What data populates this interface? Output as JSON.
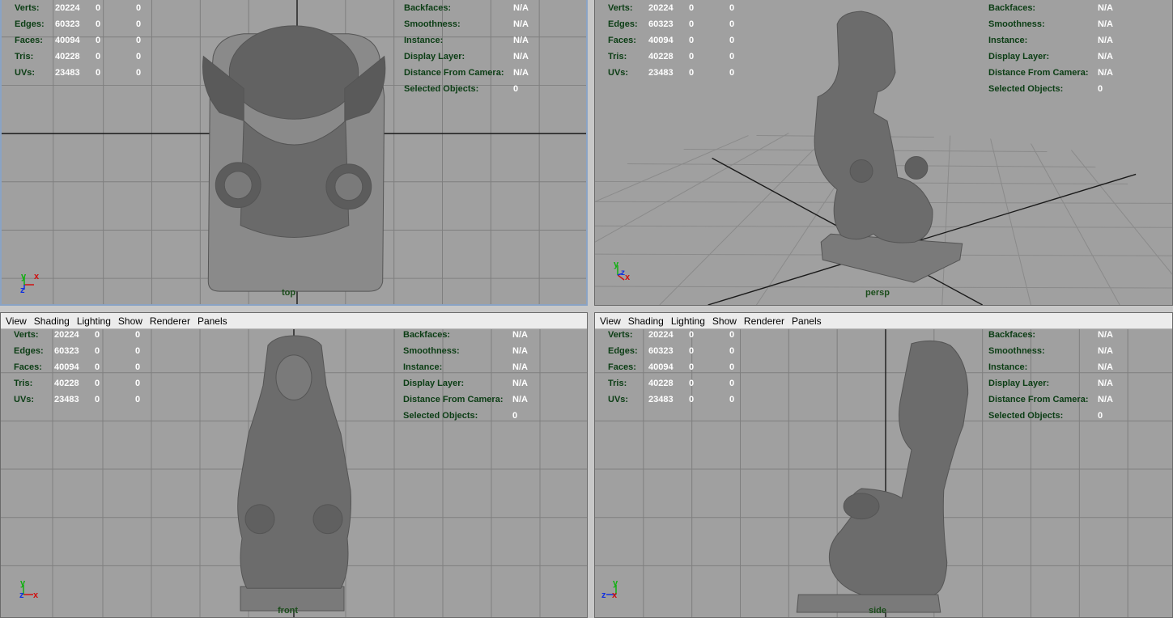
{
  "panel_menu": [
    "View",
    "Shading",
    "Lighting",
    "Show",
    "Renderer",
    "Panels"
  ],
  "hud_left": [
    {
      "key": "Verts:",
      "value": "20224",
      "a": "0",
      "b": "0"
    },
    {
      "key": "Edges:",
      "value": "60323",
      "a": "0",
      "b": "0"
    },
    {
      "key": "Faces:",
      "value": "40094",
      "a": "0",
      "b": "0"
    },
    {
      "key": "Tris:",
      "value": "40228",
      "a": "0",
      "b": "0"
    },
    {
      "key": "UVs:",
      "value": "23483",
      "a": "0",
      "b": "0"
    }
  ],
  "hud_right": [
    {
      "key": "Backfaces:",
      "value": "N/A"
    },
    {
      "key": "Smoothness:",
      "value": "N/A"
    },
    {
      "key": "Instance:",
      "value": "N/A"
    },
    {
      "key": "Display Layer:",
      "value": "N/A"
    },
    {
      "key": "Distance From Camera:",
      "value": "N/A"
    },
    {
      "key": "Selected Objects:",
      "value": "0"
    }
  ],
  "viewports": {
    "top": {
      "camera": "top"
    },
    "persp": {
      "camera": "persp"
    },
    "front": {
      "camera": "front"
    },
    "side": {
      "camera": "side"
    }
  },
  "axis_labels": {
    "x": "x",
    "y": "y",
    "z": "z"
  },
  "colors": {
    "viewport_bg": "#a0a0a0",
    "grid": "#7f7f7f",
    "grid_axis": "#1a1a1a",
    "mesh": "#6e6e6e",
    "axis_x": "#d01010",
    "axis_y": "#10b010",
    "axis_z": "#1030e0",
    "hud_label": "#0b3d14"
  }
}
